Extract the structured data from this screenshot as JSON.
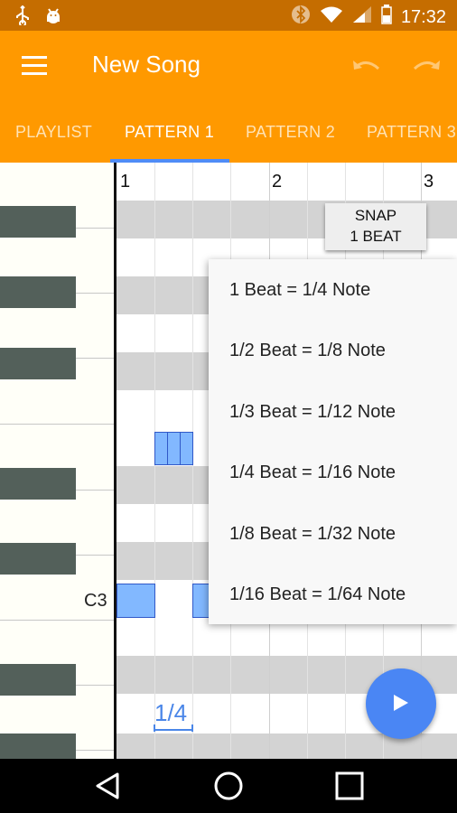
{
  "status_bar": {
    "time": "17:32",
    "icons": [
      "usb-icon",
      "android-debug-icon",
      "bluetooth-icon",
      "wifi-icon",
      "signal-icon",
      "battery-icon"
    ]
  },
  "app_bar": {
    "title": "New Song",
    "icons": [
      "menu-icon",
      "undo-icon",
      "redo-icon"
    ]
  },
  "tabs": [
    {
      "label": "PLAYLIST"
    },
    {
      "label": "PATTERN 1"
    },
    {
      "label": "PATTERN 2"
    },
    {
      "label": "PATTERN 3"
    }
  ],
  "active_tab": "PATTERN 1",
  "editor": {
    "bar_numbers": [
      "1",
      "2",
      "3"
    ],
    "key_label": "C3",
    "zoom_label": "1/4"
  },
  "snap_button": {
    "line1": "SNAP",
    "line2": "1 BEAT"
  },
  "snap_menu": {
    "items": [
      "1 Beat = 1/4 Note",
      "1/2 Beat = 1/8 Note",
      "1/3 Beat = 1/12 Note",
      "1/4 Beat = 1/16 Note",
      "1/8 Beat = 1/32 Note",
      "1/16 Beat = 1/64 Note"
    ]
  },
  "fab": {
    "icon": "play-icon"
  },
  "nav_bar": {
    "icons": [
      "back-icon",
      "home-icon",
      "recents-icon"
    ]
  },
  "colors": {
    "status_bar": "#c56d00",
    "app_bar": "#ff9900",
    "tab_indicator": "#4f8cf7",
    "note_fill": "#82b8ff",
    "note_border": "#3058c8",
    "fab": "#4a86f4",
    "black_key": "#53605a"
  }
}
